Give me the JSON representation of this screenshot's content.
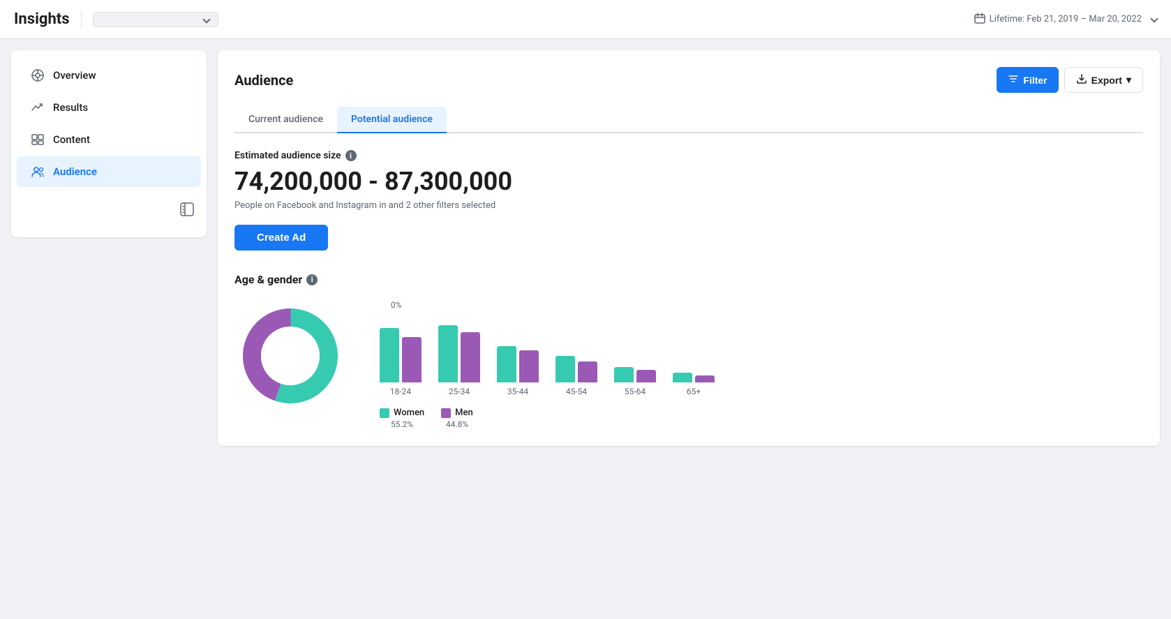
{
  "header": {
    "title": "Insights",
    "dropdown_placeholder": "",
    "date_range": "Lifetime: Feb 21, 2019 – Mar 20, 2022"
  },
  "sidebar": {
    "items": [
      {
        "id": "overview",
        "label": "Overview",
        "icon": "overview-icon",
        "active": false
      },
      {
        "id": "results",
        "label": "Results",
        "icon": "results-icon",
        "active": false
      },
      {
        "id": "content",
        "label": "Content",
        "icon": "content-icon",
        "active": false
      },
      {
        "id": "audience",
        "label": "Audience",
        "icon": "audience-icon",
        "active": true
      }
    ]
  },
  "main": {
    "section_title": "Audience",
    "filter_label": "Filter",
    "export_label": "Export",
    "tabs": [
      {
        "id": "current",
        "label": "Current audience",
        "active": false
      },
      {
        "id": "potential",
        "label": "Potential audience",
        "active": true
      }
    ],
    "estimated_size_label": "Estimated audience size",
    "audience_size": "74,200,000 - 87,300,000",
    "audience_desc": "People on Facebook and Instagram in          and 2 other filters selected",
    "create_ad_label": "Create Ad",
    "age_gender_title": "Age & gender",
    "chart": {
      "donut": {
        "women_pct": 55.2,
        "men_pct": 44.8,
        "women_color": "#36cbb0",
        "men_color": "#9b59b6"
      },
      "bars": [
        {
          "age": "18-24",
          "women_height": 78,
          "men_height": 65
        },
        {
          "age": "25-34",
          "women_height": 82,
          "men_height": 72
        },
        {
          "age": "35-44",
          "women_height": 52,
          "men_height": 46
        },
        {
          "age": "45-54",
          "women_height": 38,
          "men_height": 30
        },
        {
          "age": "55-64",
          "women_height": 22,
          "men_height": 18
        },
        {
          "age": "65+",
          "women_height": 14,
          "men_height": 10
        }
      ],
      "legend": [
        {
          "label": "Women",
          "pct": "55.2%",
          "color": "#36cbb0"
        },
        {
          "label": "Men",
          "pct": "44.8%",
          "color": "#9b59b6"
        }
      ]
    }
  }
}
